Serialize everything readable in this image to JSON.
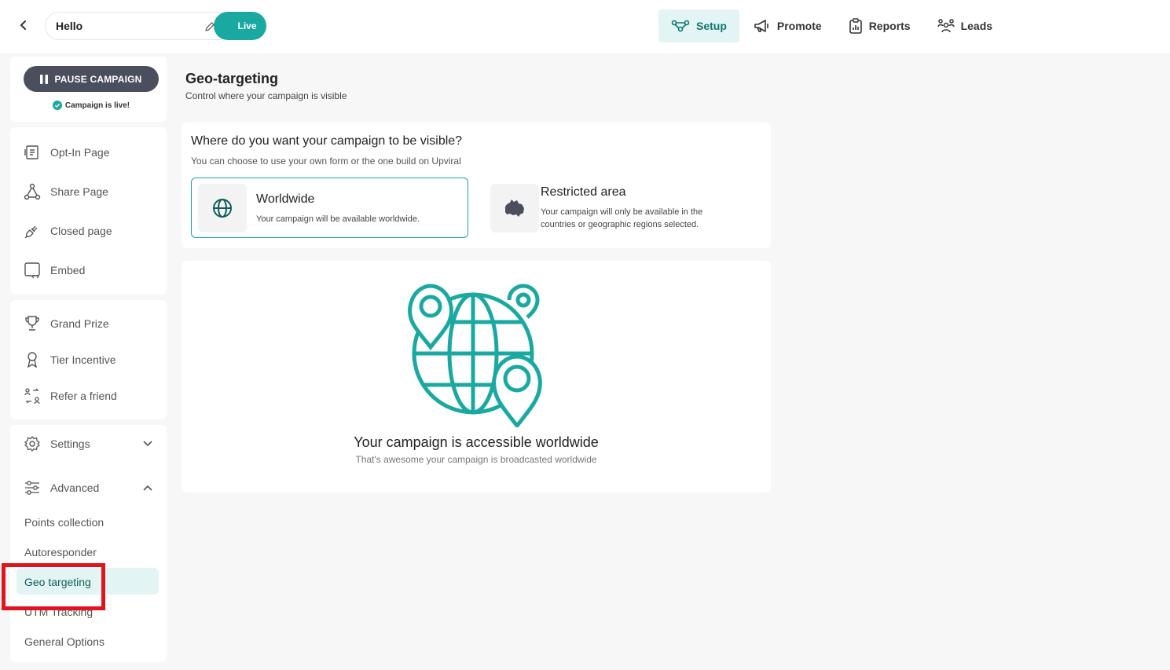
{
  "header": {
    "campaign_name": "Hello",
    "status_label": "Live",
    "nav": [
      {
        "label": "Setup",
        "icon": "setup-icon",
        "active": true
      },
      {
        "label": "Promote",
        "icon": "megaphone-icon",
        "active": false
      },
      {
        "label": "Reports",
        "icon": "clipboard-icon",
        "active": false
      },
      {
        "label": "Leads",
        "icon": "people-icon",
        "active": false
      }
    ]
  },
  "sidebar": {
    "pause_label": "PAUSE CAMPAIGN",
    "live_note": "Campaign is live!",
    "pages": [
      {
        "label": "Opt-In Page",
        "icon": "optin-page-icon"
      },
      {
        "label": "Share Page",
        "icon": "share-icon"
      },
      {
        "label": "Closed page",
        "icon": "plug-icon"
      },
      {
        "label": "Embed",
        "icon": "embed-icon"
      }
    ],
    "incentives": [
      {
        "label": "Grand Prize",
        "icon": "trophy-icon"
      },
      {
        "label": "Tier Incentive",
        "icon": "medal-icon"
      },
      {
        "label": "Refer a friend",
        "icon": "refer-icon"
      }
    ],
    "settings_label": "Settings",
    "advanced_label": "Advanced",
    "advanced_items": [
      {
        "label": "Points collection"
      },
      {
        "label": "Autoresponder"
      },
      {
        "label": "Geo targeting",
        "active": true
      },
      {
        "label": "UTM Tracking"
      },
      {
        "label": "General Options"
      }
    ]
  },
  "main": {
    "title": "Geo-targeting",
    "subtitle": "Control where your campaign is visible",
    "question": "Where do you want your campaign to be visible?",
    "question_sub": "You can choose to use your own form or the one build on Upviral",
    "options": {
      "worldwide": {
        "title": "Worldwide",
        "desc": "Your campaign will be available worldwide."
      },
      "restricted": {
        "title": "Restricted area",
        "desc_line1": "Your campaign will only be available in the",
        "desc_line2": "countries or geographic regions selected."
      }
    },
    "info_title": "Your campaign is accessible worldwide",
    "info_sub": "That's awesome your campaign is broadcasted worldwide"
  },
  "colors": {
    "accent": "#1aa9a0",
    "accent_light": "#e2f4f3",
    "pause_button": "#4b4e5c",
    "highlight": "#e0141c"
  }
}
